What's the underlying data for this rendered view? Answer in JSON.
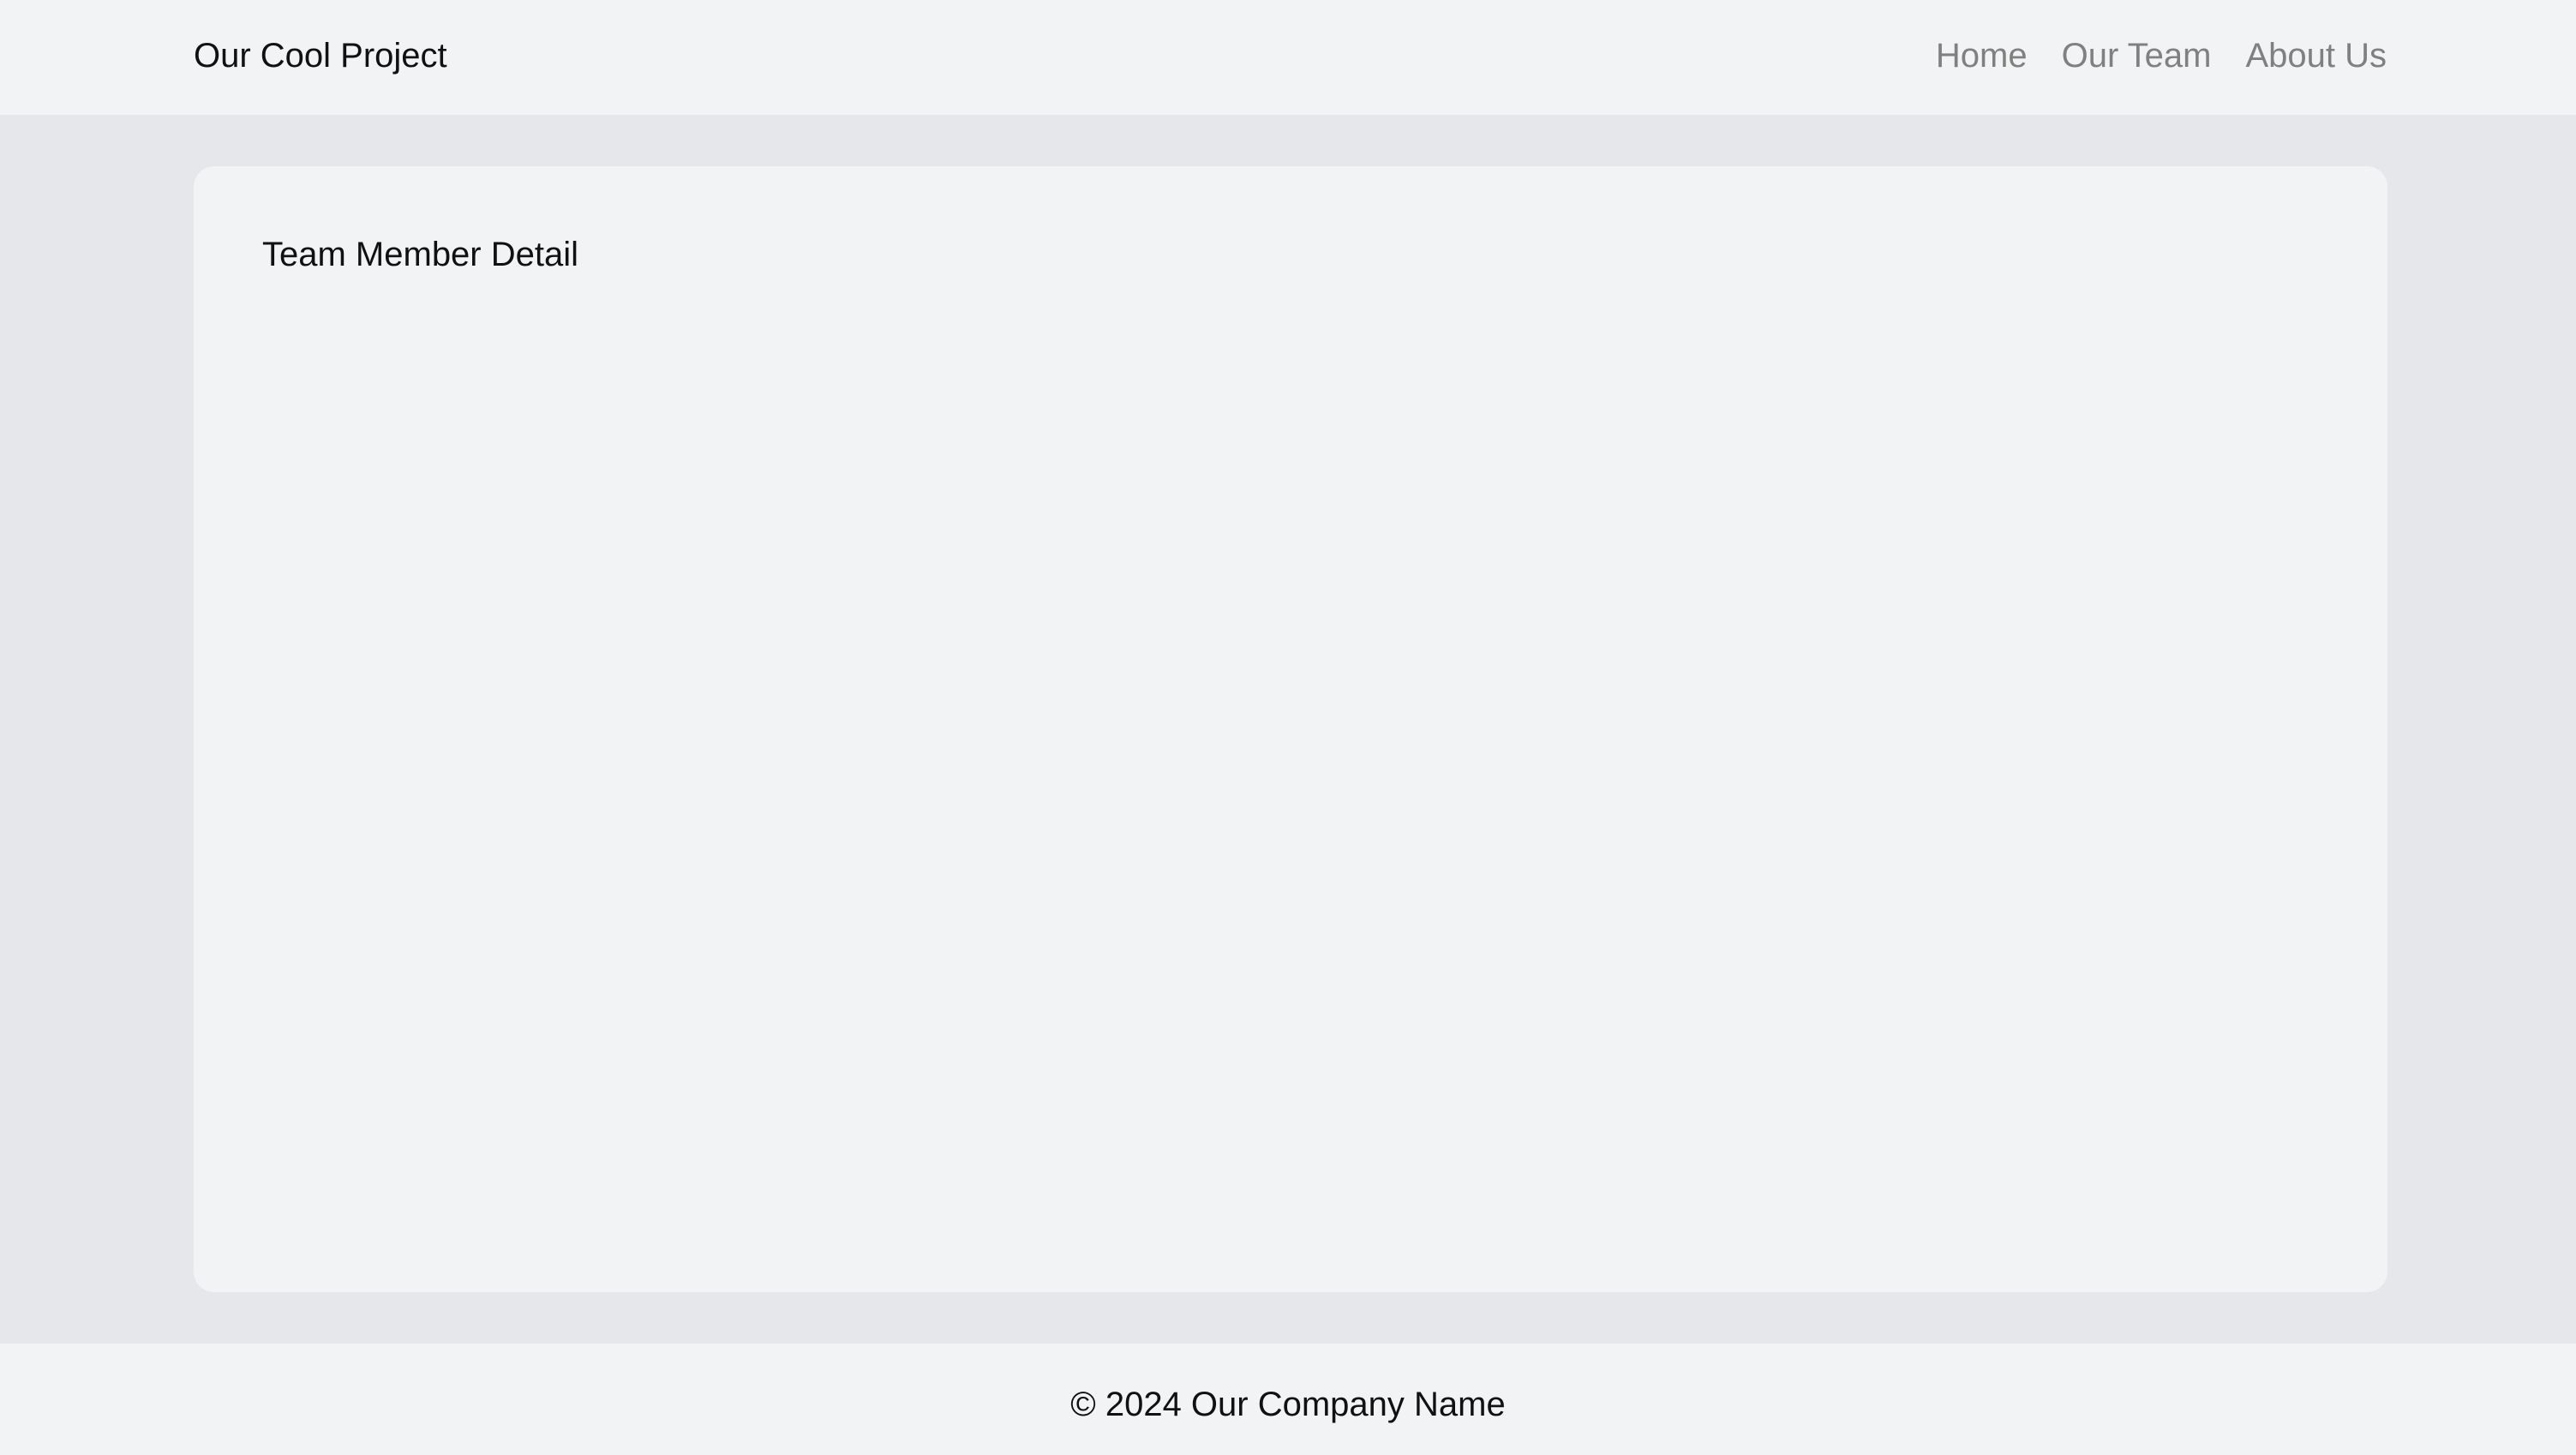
{
  "header": {
    "brand": "Our Cool Project",
    "nav": [
      {
        "label": "Home"
      },
      {
        "label": "Our Team"
      },
      {
        "label": "About Us"
      }
    ]
  },
  "main": {
    "card_title": "Team Member Detail"
  },
  "footer": {
    "copyright": "© 2024 Our Company Name"
  },
  "colors": {
    "page_background": "#e5e7eb",
    "surface": "#f2f3f5",
    "text": "#111111",
    "nav_link": "#808080"
  }
}
